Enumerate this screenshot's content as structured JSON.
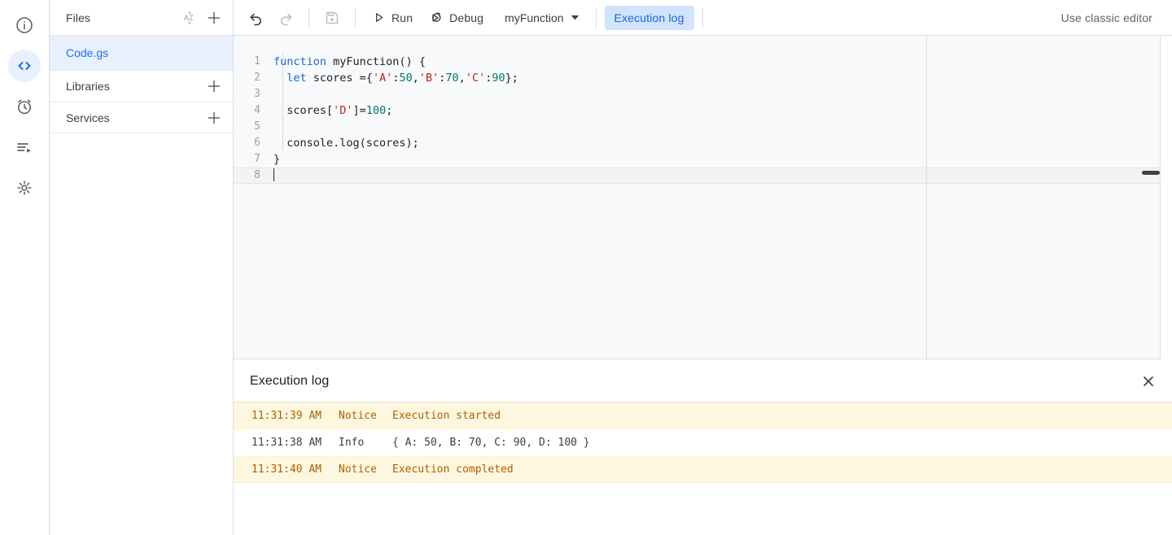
{
  "rail": {
    "items": [
      {
        "name": "overview-icon",
        "label": "Overview",
        "active": false
      },
      {
        "name": "editor-icon",
        "label": "Editor",
        "active": true
      },
      {
        "name": "triggers-icon",
        "label": "Triggers",
        "active": false
      },
      {
        "name": "executions-icon",
        "label": "Executions",
        "active": false
      },
      {
        "name": "settings-icon",
        "label": "Project Settings",
        "active": false
      }
    ]
  },
  "files_panel": {
    "header": {
      "title": "Files",
      "sort_icon": "sort-az-icon",
      "add_icon": "add-icon"
    },
    "files": [
      {
        "name": "Code.gs",
        "selected": true
      }
    ],
    "sections": [
      {
        "title": "Libraries",
        "add_icon": "add-icon"
      },
      {
        "title": "Services",
        "add_icon": "add-icon"
      }
    ]
  },
  "toolbar": {
    "undo_label": "Undo",
    "redo_label": "Redo",
    "save_label": "Save project",
    "run_label": "Run",
    "debug_label": "Debug",
    "function_select": "myFunction",
    "execution_log_label": "Execution log",
    "classic_editor_label": "Use classic editor"
  },
  "editor": {
    "lines": [
      {
        "num": "1",
        "tokens": [
          {
            "t": "kw",
            "v": "function"
          },
          {
            "t": "plain",
            "v": " myFunction() {"
          }
        ]
      },
      {
        "num": "2",
        "tokens": [
          {
            "t": "plain",
            "v": "  "
          },
          {
            "t": "kw",
            "v": "let"
          },
          {
            "t": "plain",
            "v": " scores ={"
          },
          {
            "t": "str",
            "v": "'A'"
          },
          {
            "t": "plain",
            "v": ":"
          },
          {
            "t": "num",
            "v": "50"
          },
          {
            "t": "plain",
            "v": ","
          },
          {
            "t": "str",
            "v": "'B'"
          },
          {
            "t": "plain",
            "v": ":"
          },
          {
            "t": "num",
            "v": "70"
          },
          {
            "t": "plain",
            "v": ","
          },
          {
            "t": "str",
            "v": "'C'"
          },
          {
            "t": "plain",
            "v": ":"
          },
          {
            "t": "num",
            "v": "90"
          },
          {
            "t": "plain",
            "v": "};"
          }
        ]
      },
      {
        "num": "3",
        "tokens": []
      },
      {
        "num": "4",
        "tokens": [
          {
            "t": "plain",
            "v": "  scores["
          },
          {
            "t": "str",
            "v": "'D'"
          },
          {
            "t": "plain",
            "v": "]="
          },
          {
            "t": "num",
            "v": "100"
          },
          {
            "t": "plain",
            "v": ";"
          }
        ]
      },
      {
        "num": "5",
        "tokens": []
      },
      {
        "num": "6",
        "tokens": [
          {
            "t": "plain",
            "v": "  console.log(scores);"
          }
        ]
      },
      {
        "num": "7",
        "tokens": [
          {
            "t": "plain",
            "v": "}"
          }
        ]
      },
      {
        "num": "8",
        "tokens": [],
        "active": true,
        "cursor": true
      }
    ]
  },
  "log": {
    "title": "Execution log",
    "close_icon": "close-icon",
    "columns": [
      "time",
      "type",
      "message"
    ],
    "rows": [
      {
        "time": "11:31:39 AM",
        "type": "Notice",
        "message": "Execution started",
        "level": "notice"
      },
      {
        "time": "11:31:38 AM",
        "type": "Info",
        "message": "{ A: 50, B: 70, C: 90, D: 100 }",
        "level": "info"
      },
      {
        "time": "11:31:40 AM",
        "type": "Notice",
        "message": "Execution completed",
        "level": "notice"
      }
    ]
  },
  "colors": {
    "accent_blue": "#1a73e8",
    "pill_bg": "#d2e3fc",
    "pill_text": "#1967d2",
    "selected_file_bg": "#e8f0fe",
    "notice_bg": "#fef7e0",
    "notice_text": "#b06000",
    "editor_bg": "#f8f9fa",
    "keyword": "#1967d2",
    "string": "#c5221f",
    "number": "#00796b"
  }
}
